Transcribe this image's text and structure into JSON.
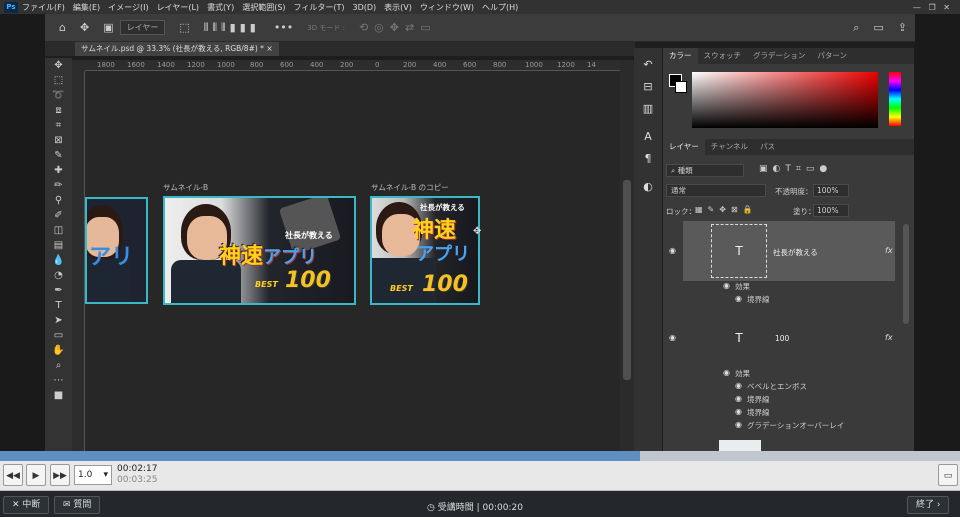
{
  "menu": {
    "items": [
      "ファイル(F)",
      "編集(E)",
      "イメージ(I)",
      "レイヤー(L)",
      "書式(Y)",
      "選択範囲(S)",
      "フィルター(T)",
      "3D(D)",
      "表示(V)",
      "ウィンドウ(W)",
      "ヘルプ(H)"
    ]
  },
  "options": {
    "layer_select": "レイヤー",
    "mode_3d": "3D モード :"
  },
  "document": {
    "tab_title": "サムネイル.psd @ 33.3% (社長が教える, RGB/8#) *",
    "ruler_ticks": [
      "1800",
      "1600",
      "1400",
      "1200",
      "1000",
      "800",
      "600",
      "400",
      "200",
      "0",
      "200",
      "400",
      "600",
      "800",
      "1000",
      "1200",
      "14"
    ]
  },
  "canvas": {
    "artboard_b_label": "サムネイル-B",
    "artboard_copy_label": "サムネイル-B のコピー",
    "thumb": {
      "line1": "社長が教える",
      "line2a": "神速",
      "line2b": "アプリ",
      "best": "BEST",
      "num": "100"
    }
  },
  "color_panel": {
    "tabs": [
      "カラー",
      "スウォッチ",
      "グラデーション",
      "パターン"
    ]
  },
  "layers_panel": {
    "tabs": [
      "レイヤー",
      "チャンネル",
      "パス"
    ],
    "filter_kind": "種類",
    "blend_mode": "通常",
    "opacity_label": "不透明度：",
    "opacity_value": "100%",
    "lock_label": "ロック：",
    "fill_label": "塗り：",
    "fill_value": "100%",
    "layer1": {
      "name": "社長が教える",
      "effects": "効果",
      "fx1": "境界線"
    },
    "layer2": {
      "name": "100",
      "effects": "効果",
      "fx1": "ベベルとエンボス",
      "fx2": "境界線",
      "fx3": "境界線",
      "fx4": "グラデーションオーバーレイ"
    },
    "fx_symbol": "fx"
  },
  "player": {
    "speed": "1.0",
    "current_time": "00:02:17",
    "total_time": "00:03:25",
    "progress": 0.667
  },
  "footer": {
    "interrupt": "中断",
    "question": "質問",
    "attend_label": "受講時間",
    "attend_time": "00:00:20",
    "end": "終了"
  }
}
